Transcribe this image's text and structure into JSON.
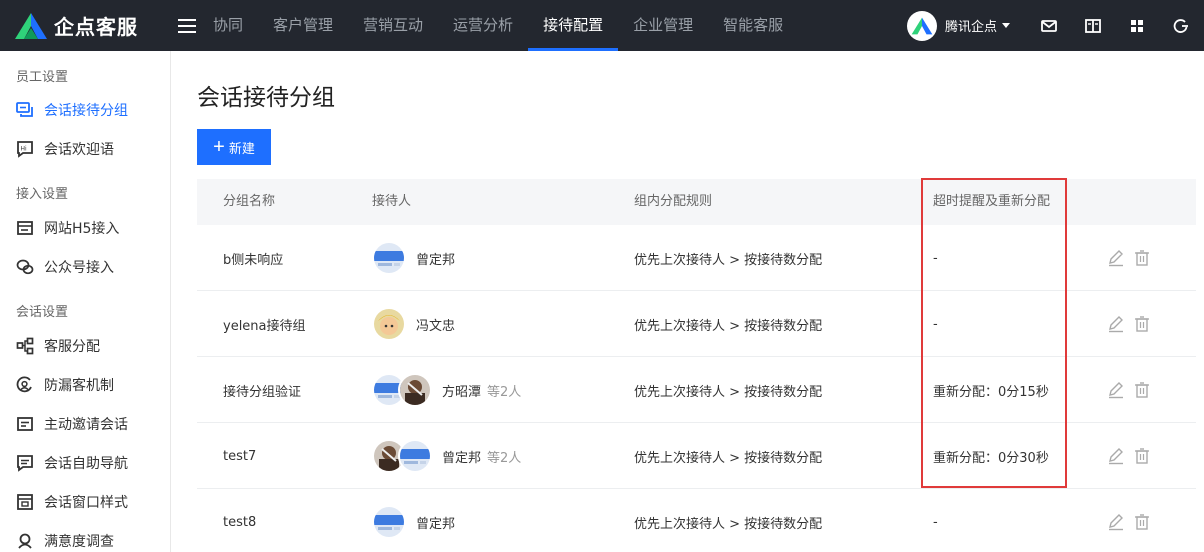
{
  "header": {
    "brand": "企点客服",
    "nav": [
      {
        "label": "协同",
        "active": false
      },
      {
        "label": "客户管理",
        "active": false
      },
      {
        "label": "营销互动",
        "active": false
      },
      {
        "label": "运营分析",
        "active": false
      },
      {
        "label": "接待配置",
        "active": true
      },
      {
        "label": "企业管理",
        "active": false
      },
      {
        "label": "智能客服",
        "active": false
      }
    ],
    "user_name": "腾讯企点"
  },
  "sidebar": {
    "groups": [
      {
        "title": "员工设置",
        "items": [
          {
            "label": "会话接待分组",
            "icon": "chat-group-icon",
            "active": true
          },
          {
            "label": "会话欢迎语",
            "icon": "welcome-message-icon",
            "active": false
          }
        ]
      },
      {
        "title": "接入设置",
        "items": [
          {
            "label": "网站H5接入",
            "icon": "website-icon",
            "active": false
          },
          {
            "label": "公众号接入",
            "icon": "wechat-icon",
            "active": false
          }
        ]
      },
      {
        "title": "会话设置",
        "items": [
          {
            "label": "客服分配",
            "icon": "distribution-icon",
            "active": false
          },
          {
            "label": "防漏客机制",
            "icon": "anti-leak-icon",
            "active": false
          },
          {
            "label": "主动邀请会话",
            "icon": "invite-icon",
            "active": false
          },
          {
            "label": "会话自助导航",
            "icon": "self-nav-icon",
            "active": false
          },
          {
            "label": "会话窗口样式",
            "icon": "window-style-icon",
            "active": false
          },
          {
            "label": "满意度调查",
            "icon": "survey-icon",
            "active": false
          }
        ]
      }
    ]
  },
  "main": {
    "title": "会话接待分组",
    "new_button": "新建",
    "table": {
      "columns": [
        "分组名称",
        "接待人",
        "组内分配规则",
        "超时提醒及重新分配"
      ],
      "rows": [
        {
          "name": "b侧未响应",
          "agent": "曾定邦",
          "more": "",
          "avatars": [
            "blue"
          ],
          "rule": "优先上次接待人 > 按接待数分配",
          "timeout": "-"
        },
        {
          "name": "yelena接待组",
          "agent": "冯文忠",
          "more": "",
          "avatars": [
            "cartoon"
          ],
          "rule": "优先上次接待人 > 按接待数分配",
          "timeout": "-"
        },
        {
          "name": "接待分组验证",
          "agent": "方昭潭",
          "more": "等2人",
          "avatars": [
            "blue",
            "dark"
          ],
          "rule": "优先上次接待人 > 按接待数分配",
          "timeout": "重新分配：0分15秒"
        },
        {
          "name": "test7",
          "agent": "曾定邦",
          "more": "等2人",
          "avatars": [
            "dark",
            "blue"
          ],
          "rule": "优先上次接待人 > 按接待数分配",
          "timeout": "重新分配：0分30秒"
        },
        {
          "name": "test8",
          "agent": "曾定邦",
          "more": "",
          "avatars": [
            "blue"
          ],
          "rule": "优先上次接待人 > 按接待数分配",
          "timeout": "-"
        }
      ]
    }
  },
  "colors": {
    "accent": "#1e6fff",
    "topbar": "#23272f",
    "highlight": "#e03a3a"
  }
}
